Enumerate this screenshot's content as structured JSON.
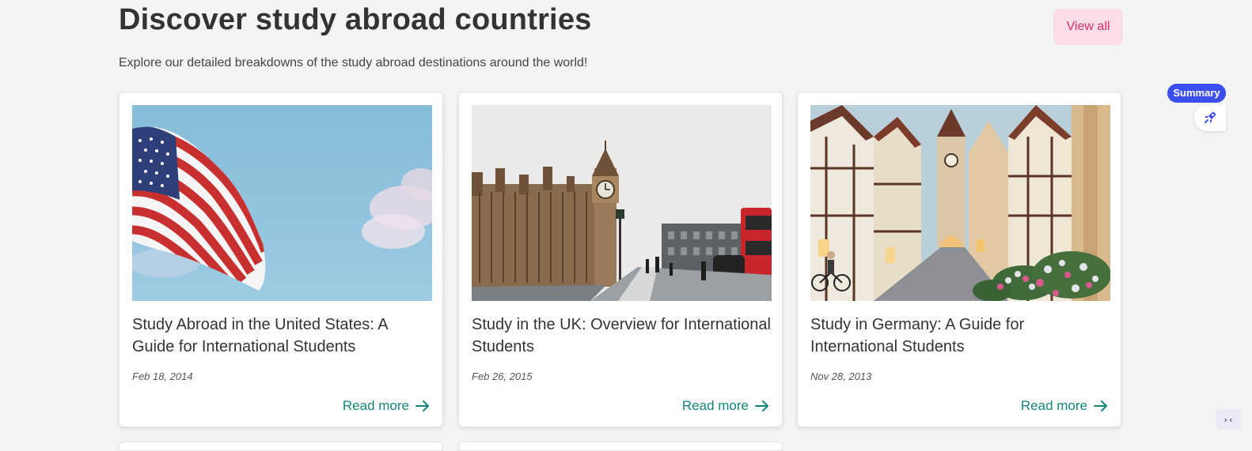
{
  "header": {
    "title": "Discover study abroad countries",
    "subtitle": "Explore our detailed breakdowns of the study abroad destinations around the world!",
    "view_all_label": "View all"
  },
  "cards": [
    {
      "title": "Study Abroad in the United States: A Guide for International Students",
      "date": "Feb 18, 2014",
      "read_more": "Read more",
      "image": "us-flag-image"
    },
    {
      "title": "Study in the UK: Overview for International Students",
      "date": "Feb 26, 2015",
      "read_more": "Read more",
      "image": "london-big-ben-image"
    },
    {
      "title": "Study in Germany: A Guide for International Students",
      "date": "Nov 28, 2013",
      "read_more": "Read more",
      "image": "german-town-street-image"
    }
  ],
  "widgets": {
    "summary_label": "Summary",
    "rocket_icon": "rocket-icon",
    "corner_glyph": "›‹"
  },
  "colors": {
    "accent_teal": "#12857a",
    "view_all_text": "#d92f68",
    "view_all_bg": "#fbdde6",
    "summary_bg": "#3b4ff1"
  }
}
